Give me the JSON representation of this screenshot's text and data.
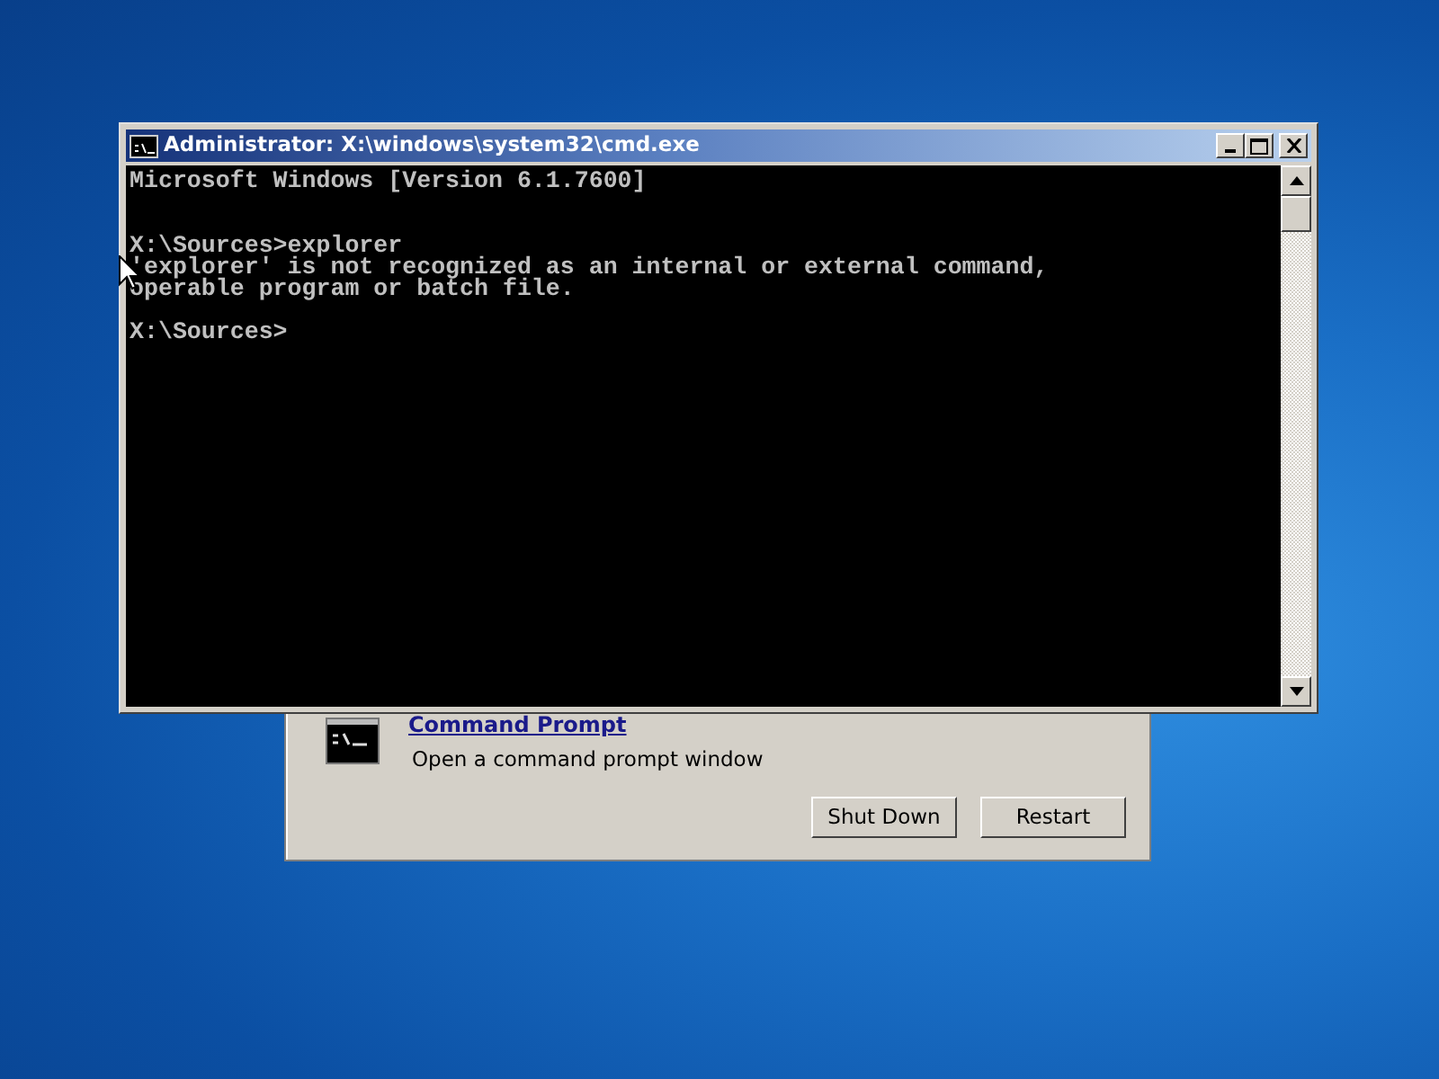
{
  "console_window": {
    "title": "Administrator: X:\\windows\\system32\\cmd.exe",
    "output": [
      {
        "kind": "line",
        "text": "Microsoft Windows [Version 6.1.7600]"
      },
      {
        "kind": "blank"
      },
      {
        "kind": "blank"
      },
      {
        "kind": "line",
        "text": "X:\\Sources>explorer"
      },
      {
        "kind": "line",
        "text": "'explorer' is not recognized as an internal or external command,"
      },
      {
        "kind": "line",
        "text": "operable program or batch file."
      },
      {
        "kind": "blank"
      },
      {
        "kind": "line",
        "text": "X:\\Sources>"
      }
    ]
  },
  "recovery_dialog": {
    "tool": {
      "title": "Command Prompt",
      "description": "Open a command prompt window"
    },
    "buttons": [
      "Shut Down",
      "Restart"
    ]
  }
}
